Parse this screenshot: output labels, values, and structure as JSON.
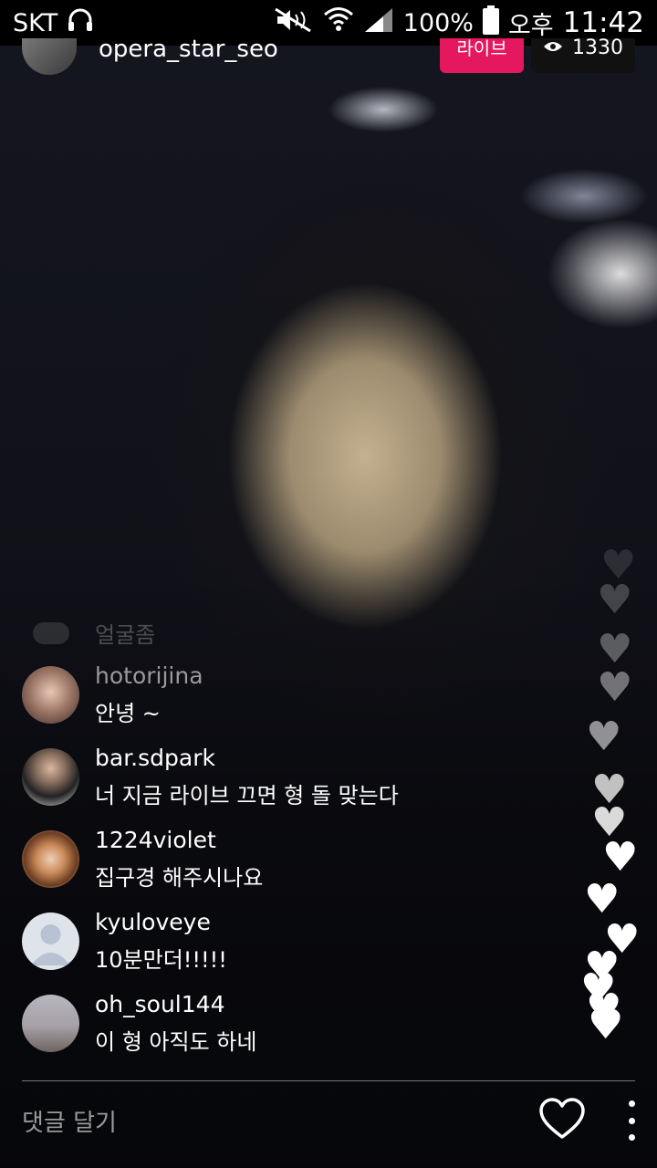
{
  "status_bar": {
    "carrier": "SKT",
    "battery": "100%",
    "ampm": "오후",
    "time": "11:42"
  },
  "header": {
    "username": "opera_star_seo",
    "live_label": "라이브",
    "viewer_count": "1330"
  },
  "faded_comment": "얼굴좀",
  "comments": [
    {
      "username": "hotorijina",
      "text": "안녕 ~"
    },
    {
      "username": "bar.sdpark",
      "text": "너 지금 라이브 끄면 형 돌 맞는다"
    },
    {
      "username": "1224violet",
      "text": "집구경 해주시나요"
    },
    {
      "username": "kyuloveye",
      "text": "10분만더!!!!!"
    },
    {
      "username": "oh_soul144",
      "text": "이 형 아직도 하네"
    }
  ],
  "comment_input": {
    "placeholder": "댓글 달기"
  },
  "colors": {
    "live_badge": "#e5175f",
    "background": "#0a0b10"
  },
  "icons": [
    "headphones-icon",
    "mute-icon",
    "wifi-icon",
    "signal-icon",
    "battery-icon",
    "eye-icon",
    "heart-icon",
    "more-vertical-icon"
  ]
}
